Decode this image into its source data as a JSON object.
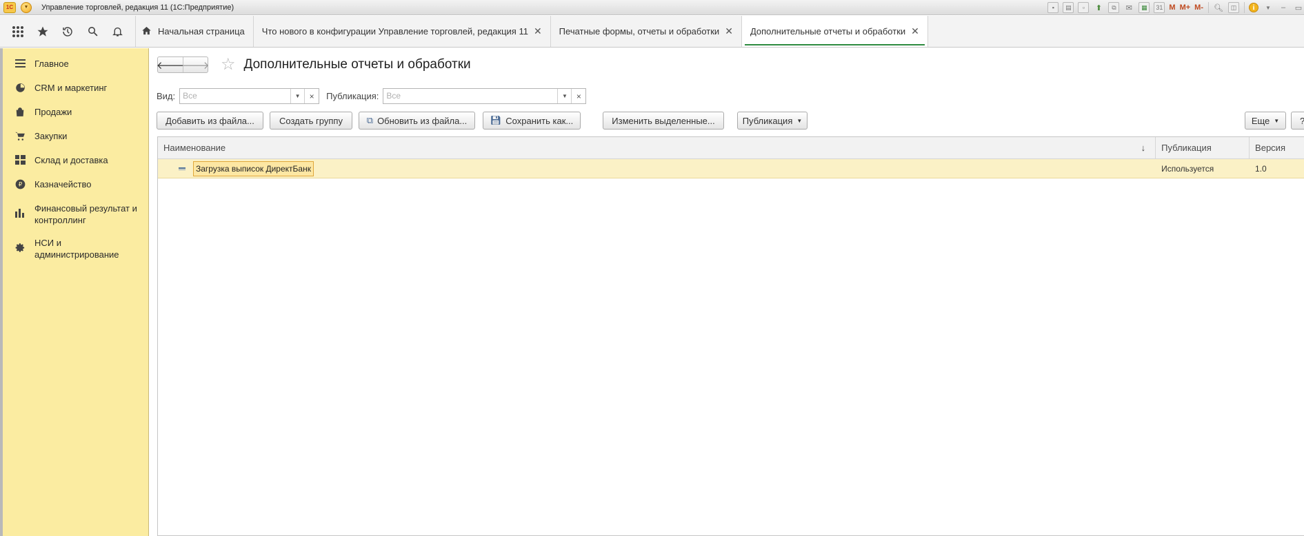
{
  "window": {
    "title": "Управление торговлей, редакция 11  (1С:Предприятие)",
    "logo_text": "1С",
    "toolbar_text": {
      "m": "M",
      "m_plus": "M+",
      "m_minus": "M-",
      "calendar": "31"
    }
  },
  "tabs": [
    {
      "label": "Начальная страница"
    },
    {
      "label": "Что нового в конфигурации Управление торговлей, редакция 11"
    },
    {
      "label": "Печатные формы, отчеты и обработки"
    },
    {
      "label": "Дополнительные отчеты и обработки"
    }
  ],
  "sidebar": {
    "items": [
      {
        "label": "Главное",
        "icon": "menu-lines-icon"
      },
      {
        "label": "CRM и маркетинг",
        "icon": "pie-chart-icon"
      },
      {
        "label": "Продажи",
        "icon": "shopping-bag-icon"
      },
      {
        "label": "Закупки",
        "icon": "cart-icon"
      },
      {
        "label": "Склад и доставка",
        "icon": "warehouse-grid-icon"
      },
      {
        "label": "Казначейство",
        "icon": "ruble-coin-icon"
      },
      {
        "label": "Финансовый результат и контроллинг",
        "icon": "bar-chart-icon"
      },
      {
        "label": "НСИ и администрирование",
        "icon": "gear-icon"
      }
    ]
  },
  "page": {
    "title": "Дополнительные отчеты и обработки",
    "filters": {
      "vid_label": "Вид:",
      "vid_value": "Все",
      "publication_label": "Публикация:",
      "publication_value": "Все"
    },
    "buttons": {
      "add_from_file": "Добавить из файла...",
      "create_group": "Создать группу",
      "update_from_file": "Обновить из файла...",
      "save_as": "Сохранить как...",
      "change_selected": "Изменить выделенные...",
      "publication": "Публикация",
      "more": "Еще",
      "help": "?"
    },
    "table": {
      "columns": [
        "Наименование",
        "Публикация",
        "Версия"
      ],
      "rows": [
        {
          "name": "Загрузка выписок ДиректБанк",
          "publication": "Используется",
          "version": "1.0"
        }
      ]
    }
  },
  "colors": {
    "sidebar_bg": "#fbeca1",
    "active_tab_underline": "#2d8a3f",
    "row_highlight": "#fbf1c6"
  }
}
